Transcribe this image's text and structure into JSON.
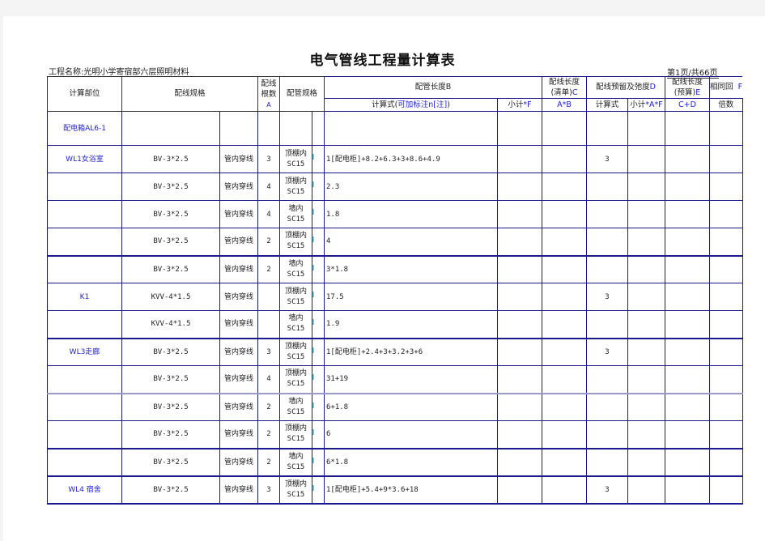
{
  "document": {
    "title": "电气管线工程量计算表",
    "project_label": "工程名称:光明小学寄宿部六层照明材料",
    "page_info": "第1页/共66页"
  },
  "header": {
    "location": "计算部位",
    "wire_spec": "配线规格",
    "wire_count_line1": "配线",
    "wire_count_line2": "根数",
    "wire_count_code": "A",
    "pipe_spec": "配管规格",
    "pipe_length": "配管长度B",
    "wire_len_list_line1": "配线长度",
    "wire_len_list_line2": "(清单)",
    "wire_len_list_code": "C",
    "reserve": "配线预留及弛度",
    "reserve_code": "D",
    "wire_len_budget_line1": "配线长度",
    "wire_len_budget_line2": "(预算)",
    "wire_len_budget_code": "E",
    "same_circuit": "相同回",
    "same_circuit_code": "F",
    "sub_formula_prefix": "计算式(",
    "sub_formula_note": "可加标注n[注]",
    "sub_formula_suffix": ")",
    "sub_subtotal": "小计",
    "sub_subtotal_code": "*F",
    "sub_axb": "A*B",
    "sub_calc": "计算式",
    "sub_subtotal2": "小计",
    "sub_subtotal2_code": "*A*F",
    "sub_cd": "C+D",
    "sub_multiple": "倍数"
  },
  "rows": [
    {
      "location": "配电箱AL6-1",
      "wire": "",
      "method": "",
      "count": "",
      "pipe_line1": "",
      "pipe_line2": "",
      "formula": "",
      "subtotal": "",
      "axb": "",
      "calc": "",
      "subtotal2": "",
      "cd": "",
      "multiple": ""
    },
    {
      "location": "WL1女浴室",
      "wire": "BV-3*2.5",
      "method": "管内穿线",
      "count": "3",
      "pipe_line1": "顶棚内",
      "pipe_line2": "SC15",
      "formula": "1[配电柜]+8.2+6.3+3+8.6+4.9",
      "subtotal": "",
      "axb": "",
      "calc": "3",
      "subtotal2": "",
      "cd": "",
      "multiple": ""
    },
    {
      "location": "",
      "wire": "BV-3*2.5",
      "method": "管内穿线",
      "count": "4",
      "pipe_line1": "顶棚内",
      "pipe_line2": "SC15",
      "formula": "2.3",
      "subtotal": "",
      "axb": "",
      "calc": "",
      "subtotal2": "",
      "cd": "",
      "multiple": ""
    },
    {
      "location": "",
      "wire": "BV-3*2.5",
      "method": "管内穿线",
      "count": "4",
      "pipe_line1": "墙内",
      "pipe_line2": "SC15",
      "formula": "1.8",
      "subtotal": "",
      "axb": "",
      "calc": "",
      "subtotal2": "",
      "cd": "",
      "multiple": ""
    },
    {
      "location": "",
      "wire": "BV-3*2.5",
      "method": "管内穿线",
      "count": "2",
      "pipe_line1": "顶棚内",
      "pipe_line2": "SC15",
      "formula": "4",
      "subtotal": "",
      "axb": "",
      "calc": "",
      "subtotal2": "",
      "cd": "",
      "multiple": ""
    },
    {
      "location": "",
      "wire": "BV-3*2.5",
      "method": "管内穿线",
      "count": "2",
      "pipe_line1": "墙内",
      "pipe_line2": "SC15",
      "formula": "3*1.8",
      "subtotal": "",
      "axb": "",
      "calc": "",
      "subtotal2": "",
      "cd": "",
      "multiple": ""
    },
    {
      "location": "K1",
      "wire": "KVV-4*1.5",
      "method": "管内穿线",
      "count": "",
      "pipe_line1": "顶棚内",
      "pipe_line2": "SC15",
      "formula": "17.5",
      "subtotal": "",
      "axb": "",
      "calc": "3",
      "subtotal2": "",
      "cd": "",
      "multiple": ""
    },
    {
      "location": "",
      "wire": "KVV-4*1.5",
      "method": "管内穿线",
      "count": "",
      "pipe_line1": "墙内",
      "pipe_line2": "SC15",
      "formula": "1.9",
      "subtotal": "",
      "axb": "",
      "calc": "",
      "subtotal2": "",
      "cd": "",
      "multiple": ""
    },
    {
      "location": "WL3走廊",
      "wire": "BV-3*2.5",
      "method": "管内穿线",
      "count": "3",
      "pipe_line1": "顶棚内",
      "pipe_line2": "SC15",
      "formula": "1[配电柜]+2.4+3+3.2+3+6",
      "subtotal": "",
      "axb": "",
      "calc": "3",
      "subtotal2": "",
      "cd": "",
      "multiple": ""
    },
    {
      "location": "",
      "wire": "BV-3*2.5",
      "method": "管内穿线",
      "count": "4",
      "pipe_line1": "顶棚内",
      "pipe_line2": "SC15",
      "formula": "31+19",
      "subtotal": "",
      "axb": "",
      "calc": "",
      "subtotal2": "",
      "cd": "",
      "multiple": ""
    },
    {
      "location": "",
      "wire": "BV-3*2.5",
      "method": "管内穿线",
      "count": "2",
      "pipe_line1": "墙内",
      "pipe_line2": "SC15",
      "formula": "6+1.8",
      "subtotal": "",
      "axb": "",
      "calc": "",
      "subtotal2": "",
      "cd": "",
      "multiple": ""
    },
    {
      "location": "",
      "wire": "BV-3*2.5",
      "method": "管内穿线",
      "count": "2",
      "pipe_line1": "顶棚内",
      "pipe_line2": "SC15",
      "formula": "6",
      "subtotal": "",
      "axb": "",
      "calc": "",
      "subtotal2": "",
      "cd": "",
      "multiple": ""
    },
    {
      "location": "",
      "wire": "BV-3*2.5",
      "method": "管内穿线",
      "count": "2",
      "pipe_line1": "墙内",
      "pipe_line2": "SC15",
      "formula": "6*1.8",
      "subtotal": "",
      "axb": "",
      "calc": "",
      "subtotal2": "",
      "cd": "",
      "multiple": ""
    },
    {
      "location": "WL4 宿舍",
      "wire": "BV-3*2.5",
      "method": "管内穿线",
      "count": "3",
      "pipe_line1": "顶棚内",
      "pipe_line2": "SC15",
      "formula": "1[配电柜]+5.4+9*3.6+18",
      "subtotal": "",
      "axb": "",
      "calc": "3",
      "subtotal2": "",
      "cd": "",
      "multiple": ""
    }
  ]
}
